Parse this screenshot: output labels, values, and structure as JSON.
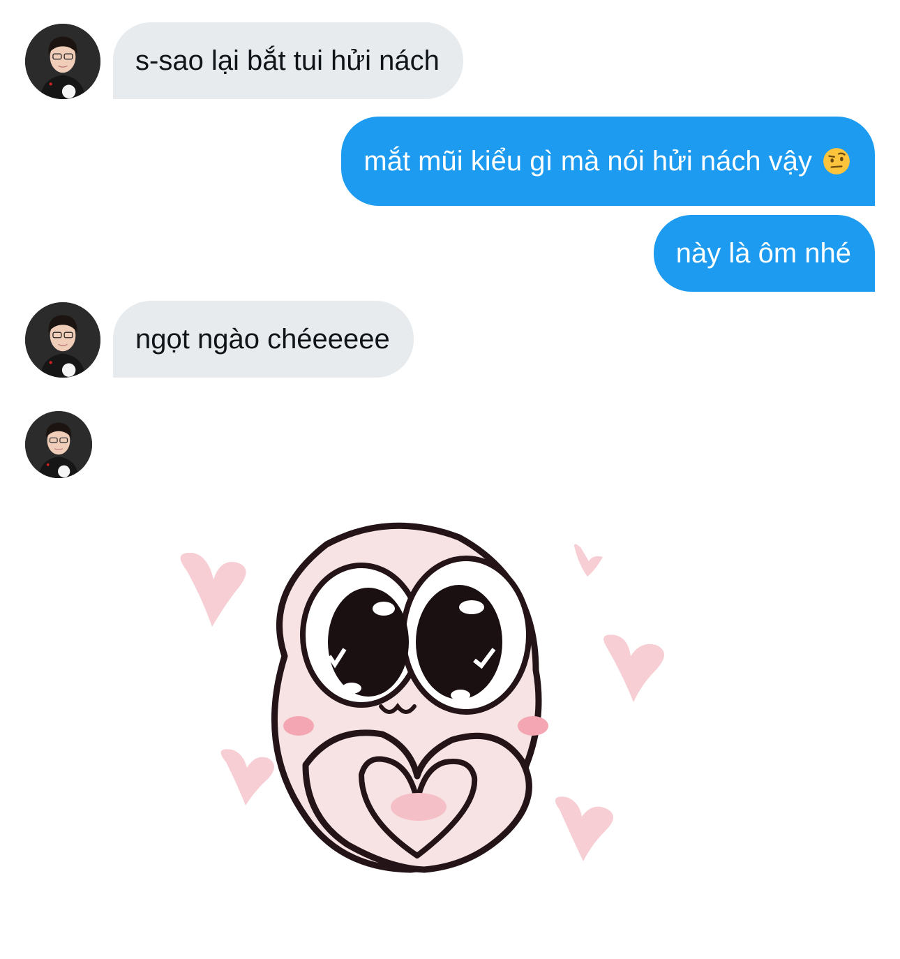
{
  "messages": [
    {
      "side": "received",
      "text": "s-sao lại bắt tui hửi nách"
    },
    {
      "side": "sent",
      "text": "mắt mũi kiểu gì mà nói hửi nách vậy",
      "emoji": "face-with-raised-eyebrow-emoji"
    },
    {
      "side": "sent",
      "text": "này là ôm nhé"
    },
    {
      "side": "received",
      "text": "ngọt ngào chéeeeee"
    },
    {
      "side": "received",
      "sticker": "heart-hands-sticker"
    }
  ],
  "colors": {
    "received_bubble": "#e7ebee",
    "sent_bubble": "#1d9bf0",
    "received_text": "#0f1419",
    "sent_text": "#ffffff"
  }
}
